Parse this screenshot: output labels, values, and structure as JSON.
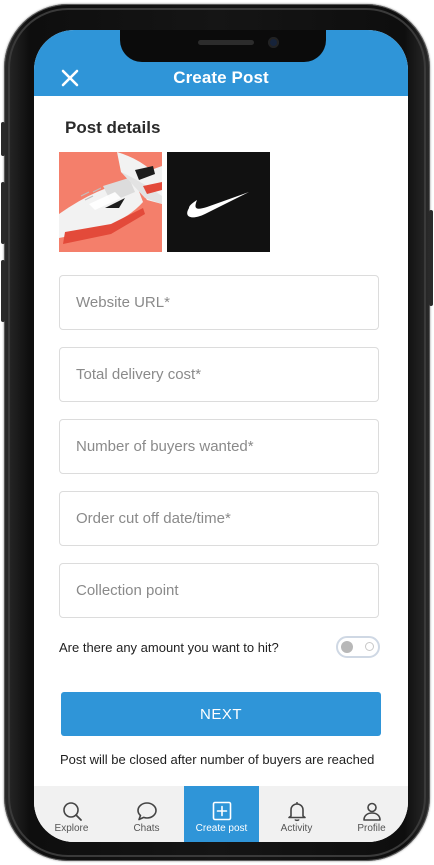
{
  "header": {
    "title": "Create Post",
    "close_icon": "close-icon"
  },
  "post_details": {
    "title": "Post details",
    "images": [
      {
        "icon": "sneaker-photo"
      },
      {
        "icon": "swoosh-logo"
      }
    ]
  },
  "form": {
    "fields": [
      {
        "placeholder": "Website URL*",
        "value": ""
      },
      {
        "placeholder": "Total delivery cost*",
        "value": ""
      },
      {
        "placeholder": "Number of buyers wanted*",
        "value": ""
      },
      {
        "placeholder": "Order cut off date/time*",
        "value": ""
      },
      {
        "placeholder": "Collection point",
        "value": ""
      }
    ],
    "toggle_label": "Are there any amount you want to hit?",
    "toggle_on": false,
    "next_label": "NEXT",
    "note": "Post will be closed after number of buyers are reached"
  },
  "tabbar": {
    "tabs": [
      {
        "label": "Explore",
        "icon": "search-icon"
      },
      {
        "label": "Chats",
        "icon": "chat-bubble-icon"
      },
      {
        "label": "Create post",
        "icon": "plus-square-icon"
      },
      {
        "label": "Activity",
        "icon": "bell-icon"
      },
      {
        "label": "Profile",
        "icon": "user-icon"
      }
    ],
    "active_index": 2
  },
  "colors": {
    "accent": "#2f95d8",
    "tabbar_bg": "#f1f1f1",
    "field_border": "#dcdcdc"
  }
}
